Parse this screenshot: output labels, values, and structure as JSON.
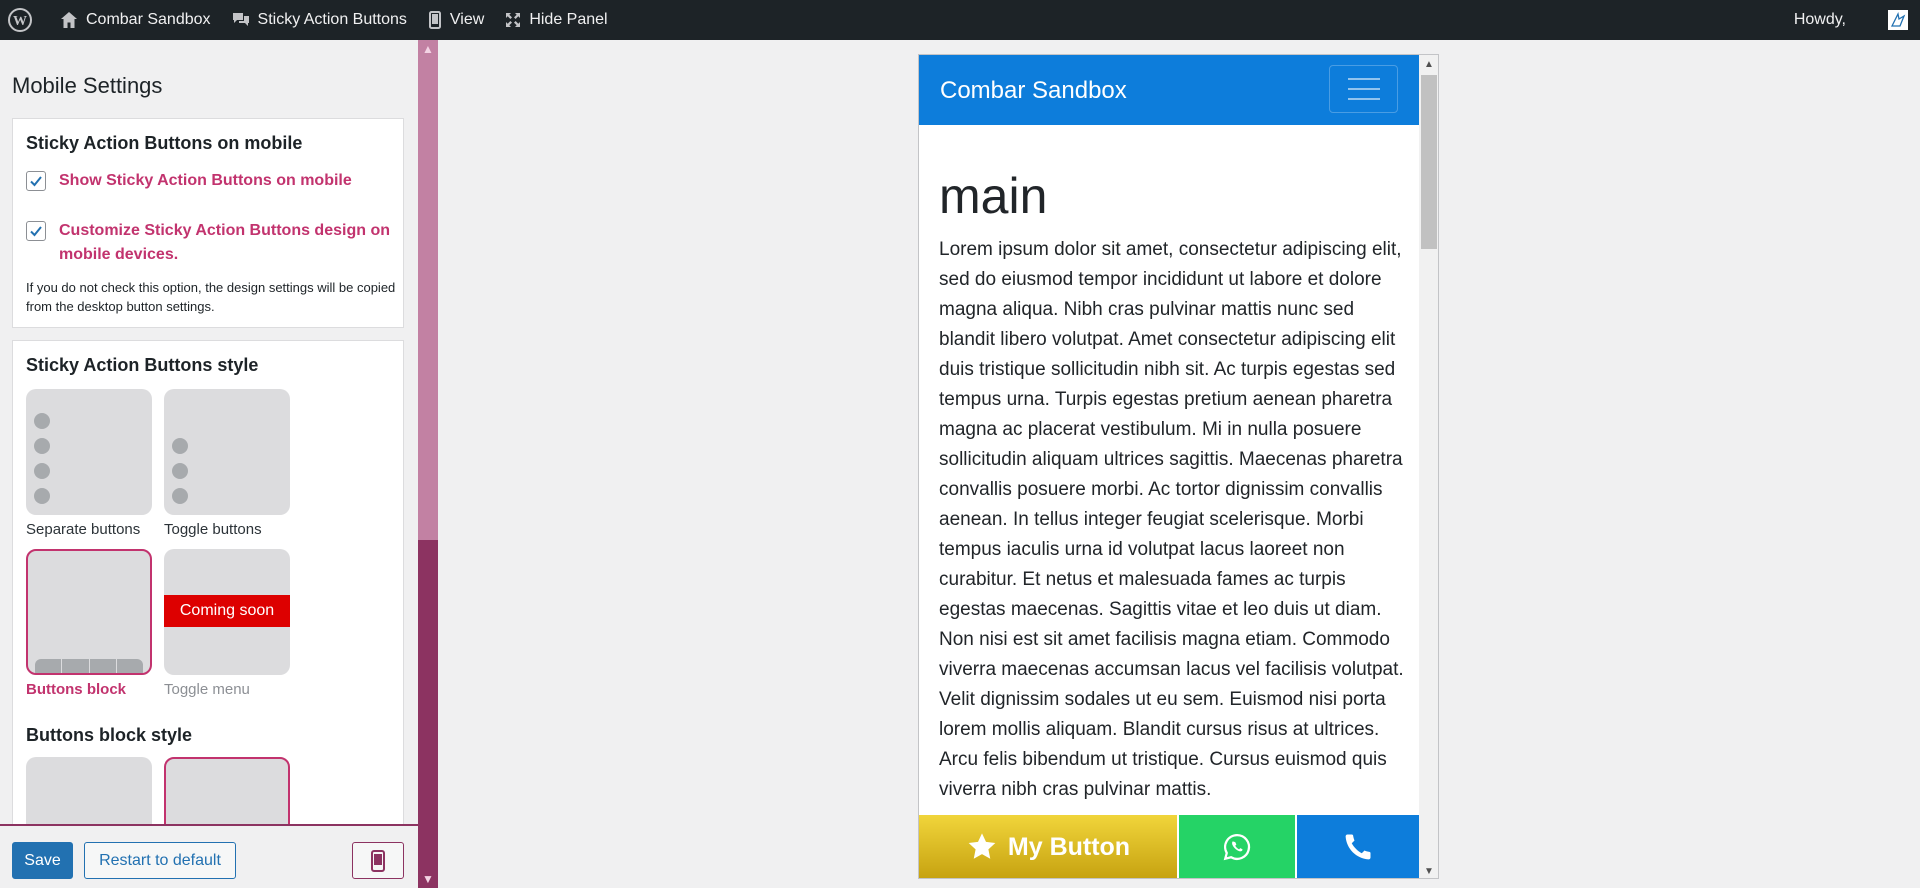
{
  "admin_bar": {
    "site_name": "Combar Sandbox",
    "plugin_name": "Sticky Action Buttons",
    "view_label": "View",
    "hide_panel_label": "Hide Panel",
    "greeting": "Howdy,"
  },
  "panel": {
    "title": "Mobile Settings",
    "mobile_section": {
      "heading": "Sticky Action Buttons on mobile",
      "show_label": "Show Sticky Action Buttons on mobile",
      "show_checked": true,
      "customize_label": "Customize Sticky Action Buttons design on mobile devices.",
      "customize_checked": true,
      "hint": "If you do not check this option, the design settings will be copied from the desktop button settings."
    },
    "style_section": {
      "heading": "Sticky Action Buttons style",
      "options": [
        {
          "label": "Separate buttons",
          "selected": false
        },
        {
          "label": "Toggle buttons",
          "selected": false
        },
        {
          "label": "Buttons block",
          "selected": true
        },
        {
          "label": "Toggle menu",
          "selected": false,
          "badge": "Coming soon"
        }
      ],
      "block_style_heading": "Buttons block style"
    },
    "footer": {
      "save_label": "Save",
      "restart_label": "Restart to default"
    }
  },
  "preview": {
    "brand": "Combar Sandbox",
    "heading": "main",
    "body_text": "Lorem ipsum dolor sit amet, consectetur adipiscing elit, sed do eiusmod tempor incididunt ut labore et dolore magna aliqua. Nibh cras pulvinar mattis nunc sed blandit libero volutpat. Amet consectetur adipiscing elit duis tristique sollicitudin nibh sit. Ac turpis egestas sed tempus urna. Turpis egestas pretium aenean pharetra magna ac placerat vestibulum. Mi in nulla posuere sollicitudin aliquam ultrices sagittis. Maecenas pharetra convallis posuere morbi. Ac tortor dignissim convallis aenean. In tellus integer feugiat scelerisque. Morbi tempus iaculis urna id volutpat lacus laoreet non curabitur. Et netus et malesuada fames ac turpis egestas maecenas. Sagittis vitae et leo duis ut diam. Non nisi est sit amet facilisis magna etiam. Commodo viverra maecenas accumsan lacus vel facilisis volutpat. Velit dignissim sodales ut eu sem. Euismod nisi porta lorem mollis aliquam. Blandit cursus risus at ultrices. Arcu felis bibendum ut tristique. Cursus euismod quis viverra nibh cras pulvinar mattis.",
    "buttons": {
      "main_label": "My Button",
      "main_icon": "star-icon",
      "second_icon": "whatsapp-icon",
      "third_icon": "phone-icon"
    }
  },
  "colors": {
    "accent": "#c2336e",
    "primary": "#2271b1",
    "preview_blue": "#0d7ddb",
    "whatsapp_green": "#25d366",
    "button_gold": "#d4b520"
  }
}
